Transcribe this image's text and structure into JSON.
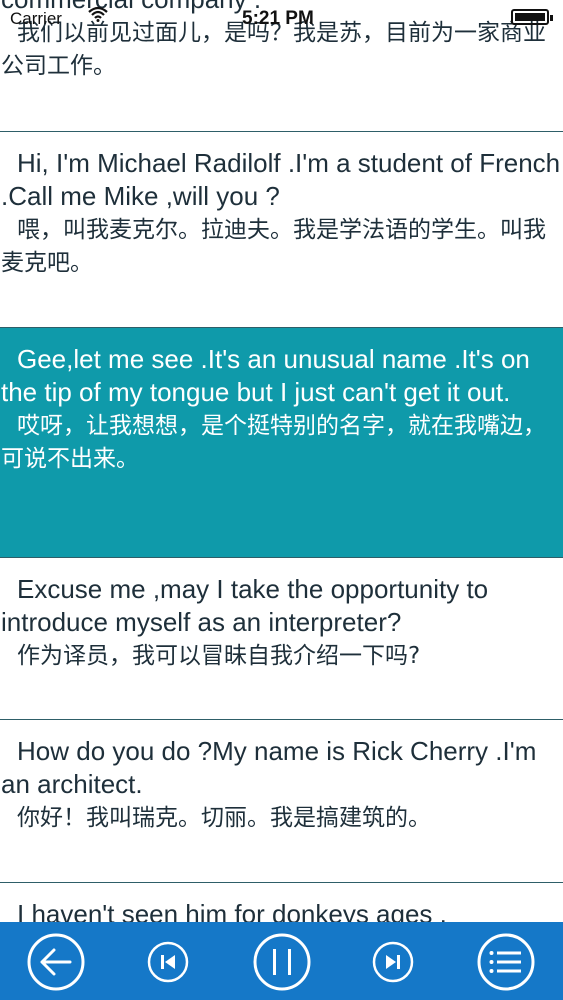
{
  "status_bar": {
    "carrier": "Carrier",
    "time": "5:21 PM"
  },
  "dialogue": [
    {
      "en": "commercial company .",
      "zh": "我们以前见过面儿，是吗？我是苏，目前为一家商业公司工作。",
      "active": false
    },
    {
      "en": "Hi, I'm Michael Radilolf .I'm a student of French .Call me Mike ,will you ?",
      "zh": "喂，叫我麦克尔。拉迪夫。我是学法语的学生。叫我麦克吧。",
      "active": false
    },
    {
      "en": "Gee,let me see .It's an unusual name .It's on the tip of my tongue but I just can't get it out.",
      "zh": "哎呀，让我想想，是个挺特别的名字，就在我嘴边，可说不出来。",
      "active": true
    },
    {
      "en": "Excuse me ,may I take the opportunity to introduce myself as an interpreter?",
      "zh": "作为译员，我可以冒昧自我介绍一下吗?",
      "active": false
    },
    {
      "en": "How do you do ?My name is Rick Cherry .I'm an architect.",
      "zh": "你好！我叫瑞克。切丽。我是搞建筑的。",
      "active": false
    },
    {
      "en": "I haven't seen him for donkeys ages .",
      "zh": "",
      "active": false
    }
  ],
  "toolbar": {
    "background": "#1578c8",
    "buttons": [
      {
        "icon": "back-arrow-icon"
      },
      {
        "icon": "previous-track-icon"
      },
      {
        "icon": "pause-icon"
      },
      {
        "icon": "next-track-icon"
      },
      {
        "icon": "menu-list-icon"
      }
    ]
  },
  "colors": {
    "active_row": "#0f9aaa",
    "text": "#1e2f3a",
    "divider": "#2e5e68"
  }
}
